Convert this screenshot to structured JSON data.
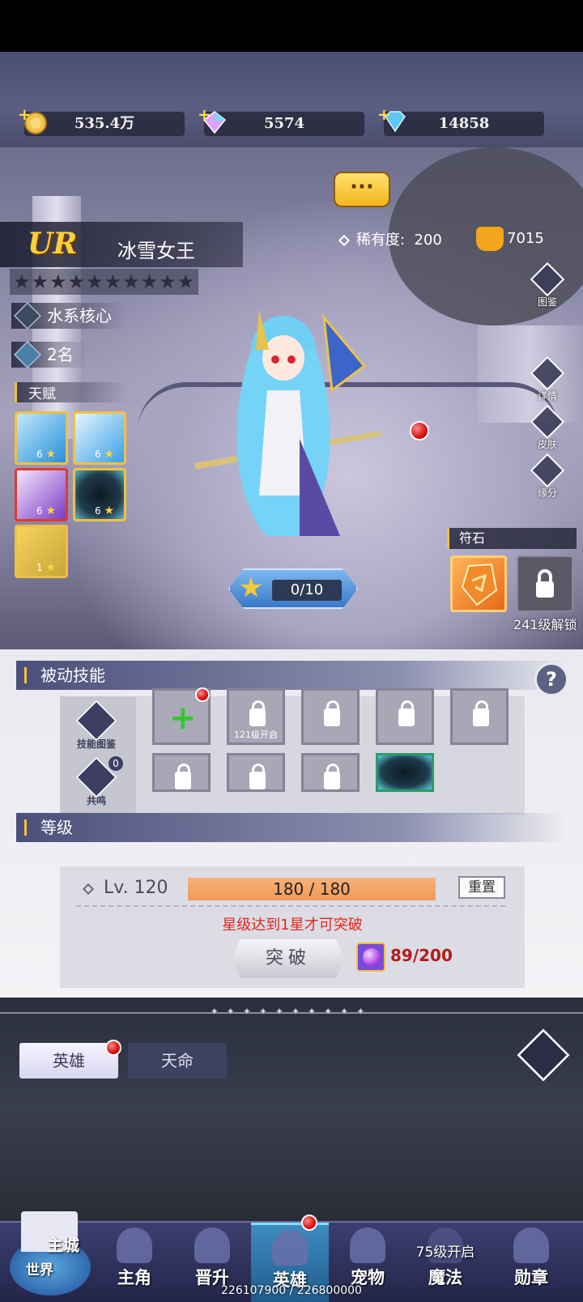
{
  "currencies": [
    {
      "name": "gold-coin",
      "value": "535.4万"
    },
    {
      "name": "rainbow-gem",
      "value": "5574"
    },
    {
      "name": "blue-diamond",
      "value": "14858"
    }
  ],
  "hero": {
    "rank": "UR",
    "name": "冰雪女王",
    "rarity_label": "稀有度:",
    "rarity_value": "200",
    "power": "7015",
    "stars": "★★★★★★★★★★",
    "role_tag": "水系核心",
    "place_tag": "2名",
    "talent_title": "天赋",
    "talents": [
      {
        "lv": "6",
        "color": "#2a8fd8"
      },
      {
        "lv": "6",
        "color": "#3aa0e6"
      },
      {
        "lv": "6",
        "color": "#7b3cc4"
      },
      {
        "lv": "6",
        "color": "#203a4a"
      },
      {
        "lv": "1",
        "color": "#caa53a"
      }
    ],
    "exp_text": "0/10",
    "chat_glyph": "···"
  },
  "side_buttons": [
    "图鉴",
    "详情",
    "皮肤",
    "缘分"
  ],
  "rune": {
    "title": "符石",
    "lock_text": "241级解锁"
  },
  "passive": {
    "title": "被动技能",
    "help": "?",
    "side": [
      {
        "label": "技能图鉴",
        "badge": ""
      },
      {
        "label": "共鸣",
        "badge": "0"
      }
    ],
    "slots": [
      {
        "type": "add",
        "caption": ""
      },
      {
        "type": "lock",
        "caption": "121级开启"
      },
      {
        "type": "lock",
        "caption": ""
      },
      {
        "type": "lock",
        "caption": ""
      },
      {
        "type": "lock",
        "caption": ""
      },
      {
        "type": "lock",
        "caption": ""
      },
      {
        "type": "lock",
        "caption": ""
      },
      {
        "type": "lock",
        "caption": ""
      },
      {
        "type": "skill",
        "caption": ""
      }
    ]
  },
  "level": {
    "title": "等级",
    "label": "Lv. 120",
    "progress": "180 / 180",
    "progress_fraction": 1.0,
    "reset": "重置",
    "warning": "星级达到1星才可突破",
    "break_btn": "突破",
    "orb_count": "89/200"
  },
  "tabs": {
    "active": "英雄",
    "inactive": "天命"
  },
  "nav": [
    {
      "label": "主角",
      "state": "normal"
    },
    {
      "label": "晋升",
      "state": "normal"
    },
    {
      "label": "英雄",
      "state": "active"
    },
    {
      "label": "宠物",
      "state": "normal"
    },
    {
      "label": "魔法",
      "state": "locked",
      "note": "75级开启"
    },
    {
      "label": "勋章",
      "state": "normal"
    }
  ],
  "main_city": {
    "line1": "主城",
    "line2": "世界"
  },
  "exp_footer": "226107900 / 226800000",
  "colors": {
    "accent_gold": "#f0c040",
    "warning_red": "#e3261f",
    "nav_active": "#3e8bc0"
  }
}
